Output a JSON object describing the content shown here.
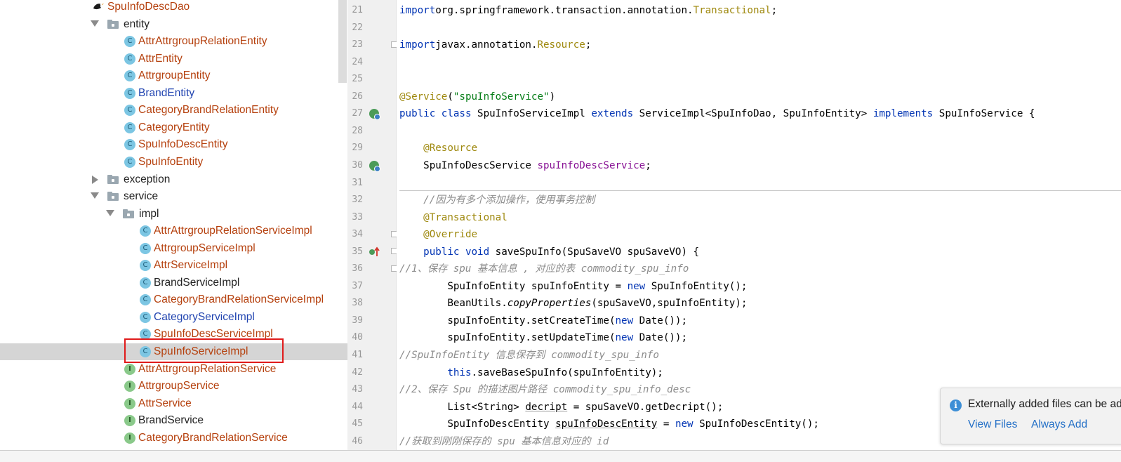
{
  "project_tree": {
    "items": [
      {
        "label": "SpuInfoDescDao",
        "kind": "dao",
        "color": "red",
        "expanded": null
      },
      {
        "label": "entity",
        "kind": "folder",
        "color": "black",
        "expanded": true
      },
      {
        "label": "AttrAttrgroupRelationEntity",
        "kind": "class",
        "color": "red"
      },
      {
        "label": "AttrEntity",
        "kind": "class",
        "color": "red"
      },
      {
        "label": "AttrgroupEntity",
        "kind": "class",
        "color": "red"
      },
      {
        "label": "BrandEntity",
        "kind": "class",
        "color": "blue"
      },
      {
        "label": "CategoryBrandRelationEntity",
        "kind": "class",
        "color": "red"
      },
      {
        "label": "CategoryEntity",
        "kind": "class",
        "color": "red"
      },
      {
        "label": "SpuInfoDescEntity",
        "kind": "class",
        "color": "red"
      },
      {
        "label": "SpuInfoEntity",
        "kind": "class",
        "color": "red"
      },
      {
        "label": "exception",
        "kind": "folder",
        "color": "black",
        "expanded": false
      },
      {
        "label": "service",
        "kind": "folder",
        "color": "black",
        "expanded": true
      },
      {
        "label": "impl",
        "kind": "folder",
        "color": "black",
        "expanded": true
      },
      {
        "label": "AttrAttrgroupRelationServiceImpl",
        "kind": "class",
        "color": "red"
      },
      {
        "label": "AttrgroupServiceImpl",
        "kind": "class",
        "color": "red"
      },
      {
        "label": "AttrServiceImpl",
        "kind": "class",
        "color": "red"
      },
      {
        "label": "BrandServiceImpl",
        "kind": "class",
        "color": "black"
      },
      {
        "label": "CategoryBrandRelationServiceImpl",
        "kind": "class",
        "color": "red"
      },
      {
        "label": "CategoryServiceImpl",
        "kind": "class",
        "color": "blue"
      },
      {
        "label": "SpuInfoDescServiceImpl",
        "kind": "class",
        "color": "red"
      },
      {
        "label": "SpuInfoServiceImpl",
        "kind": "class",
        "color": "red",
        "selected": true
      },
      {
        "label": "AttrAttrgroupRelationService",
        "kind": "interface",
        "color": "red"
      },
      {
        "label": "AttrgroupService",
        "kind": "interface",
        "color": "red"
      },
      {
        "label": "AttrService",
        "kind": "interface",
        "color": "red"
      },
      {
        "label": "BrandService",
        "kind": "interface",
        "color": "black"
      },
      {
        "label": "CategoryBrandRelationService",
        "kind": "interface",
        "color": "red"
      }
    ]
  },
  "editor": {
    "line_numbers": [
      "21",
      "22",
      "23",
      "24",
      "25",
      "26",
      "27",
      "28",
      "29",
      "30",
      "31",
      "32",
      "33",
      "34",
      "35",
      "36",
      "37",
      "38",
      "39",
      "40",
      "41",
      "42",
      "43",
      "44",
      "45",
      "46"
    ],
    "lines": [
      {
        "segments": [
          [
            "kw",
            "import"
          ],
          [
            "",
            "org.springframework.transaction.annotation."
          ],
          [
            "ann",
            "Transactional"
          ],
          [
            "",
            ";"
          ]
        ]
      },
      {
        "segments": []
      },
      {
        "segments": [
          [
            "kw",
            "import"
          ],
          [
            "",
            "javax.annotation."
          ],
          [
            "ann",
            "Resource"
          ],
          [
            "",
            ";"
          ]
        ]
      },
      {
        "segments": []
      },
      {
        "segments": []
      },
      {
        "segments": [
          [
            "ann",
            "@Service"
          ],
          [
            "",
            "("
          ],
          [
            "str",
            "\"spuInfoService\""
          ],
          [
            "",
            ")"
          ]
        ]
      },
      {
        "segments": [
          [
            "kw",
            "public class"
          ],
          [
            "",
            " SpuInfoServiceImpl "
          ],
          [
            "kw",
            "extends"
          ],
          [
            "",
            " ServiceImpl<SpuInfoDao, SpuInfoEntity> "
          ],
          [
            "kw",
            "implements"
          ],
          [
            "",
            " SpuInfoService {"
          ]
        ]
      },
      {
        "segments": []
      },
      {
        "segments": [
          [
            "",
            "    "
          ],
          [
            "ann",
            "@Resource"
          ]
        ]
      },
      {
        "segments": [
          [
            "",
            "    SpuInfoDescService "
          ],
          [
            "fld",
            "spuInfoDescService"
          ],
          [
            "",
            ";"
          ]
        ]
      },
      {
        "segments": []
      },
      {
        "segments": [
          [
            "",
            "    "
          ],
          [
            "cmt",
            "//因为有多个添加操作，使用事务控制"
          ]
        ]
      },
      {
        "segments": [
          [
            "",
            "    "
          ],
          [
            "ann",
            "@Transactional"
          ]
        ]
      },
      {
        "segments": [
          [
            "",
            "    "
          ],
          [
            "ann",
            "@Override"
          ]
        ]
      },
      {
        "segments": [
          [
            "",
            "    "
          ],
          [
            "kw",
            "public void"
          ],
          [
            "",
            " saveSpuInfo(SpuSaveVO spuSaveVO) {"
          ]
        ]
      },
      {
        "segments": [
          [
            "cmt",
            "//1、保存 spu 基本信息 , 对应的表 commodity_spu_info"
          ]
        ]
      },
      {
        "segments": [
          [
            "",
            "        SpuInfoEntity spuInfoEntity = "
          ],
          [
            "kw",
            "new"
          ],
          [
            "",
            " SpuInfoEntity();"
          ]
        ]
      },
      {
        "segments": [
          [
            "",
            "        BeanUtils."
          ],
          [
            "it",
            "copyProperties"
          ],
          [
            "",
            "(spuSaveVO,spuInfoEntity);"
          ]
        ]
      },
      {
        "segments": [
          [
            "",
            "        spuInfoEntity.setCreateTime("
          ],
          [
            "kw",
            "new"
          ],
          [
            "",
            " Date());"
          ]
        ]
      },
      {
        "segments": [
          [
            "",
            "        spuInfoEntity.setUpdateTime("
          ],
          [
            "kw",
            "new"
          ],
          [
            "",
            " Date());"
          ]
        ]
      },
      {
        "segments": [
          [
            "cmt",
            "//SpuInfoEntity 信息保存到 commodity_spu_info"
          ]
        ]
      },
      {
        "segments": [
          [
            "",
            "        "
          ],
          [
            "kw",
            "this"
          ],
          [
            "",
            ".saveBaseSpuInfo(spuInfoEntity);"
          ]
        ]
      },
      {
        "segments": [
          [
            "cmt",
            "//2、保存 Spu 的描述图片路径 commodity_spu_info_desc"
          ]
        ]
      },
      {
        "segments": [
          [
            "",
            "        List<String> "
          ],
          [
            "ul",
            "decript"
          ],
          [
            "",
            " = spuSaveVO.getDecript();"
          ]
        ]
      },
      {
        "segments": [
          [
            "",
            "        SpuInfoDescEntity "
          ],
          [
            "ul",
            "spuInfoDescEntity"
          ],
          [
            "",
            " = "
          ],
          [
            "kw",
            "new"
          ],
          [
            "",
            " SpuInfoDescEntity();"
          ]
        ]
      },
      {
        "segments": [
          [
            "cmt",
            "//获取到刚刚保存的 spu 基本信息对应的 id"
          ]
        ]
      }
    ]
  },
  "notification": {
    "message": "Externally added files can be added to Git",
    "action_view": "View Files",
    "action_add": "Always Add"
  },
  "colors": {
    "keyword": "#0033b3",
    "annotation": "#9e880d",
    "string": "#067d17",
    "field": "#871094",
    "comment": "#8c8c8c",
    "tree_red": "#b5400d",
    "tree_blue": "#2144b0",
    "selection_border": "#e01b1b"
  },
  "icons": {
    "class": "class-icon",
    "interface": "interface-icon",
    "folder": "package-folder-icon",
    "dao": "mybatis-bird-icon",
    "info": "info-icon"
  }
}
